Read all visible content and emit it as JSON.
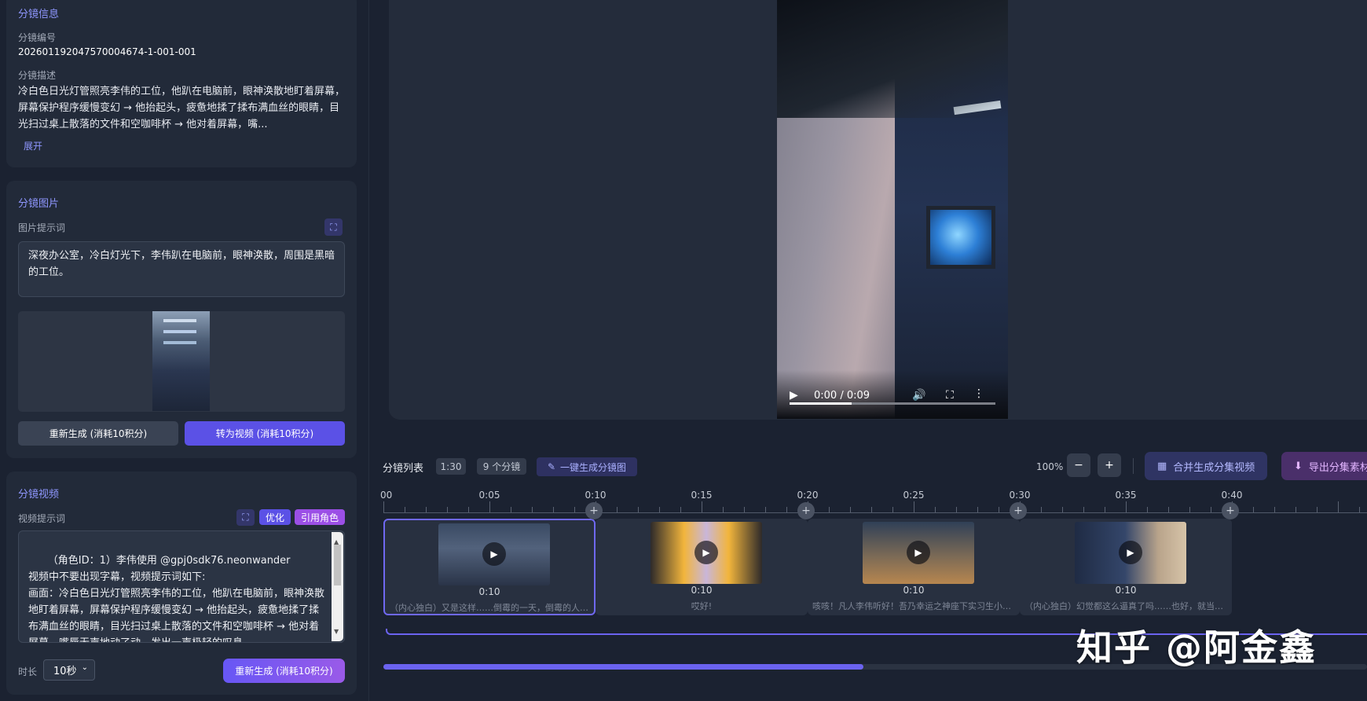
{
  "storyboard_info": {
    "title": "分镜信息",
    "id_label": "分镜编号",
    "id_value": "20260119204757000467­4-1-001-001",
    "desc_label": "分镜描述",
    "desc_text": "冷白色日光灯管照亮李伟的工位，他趴在电脑前，眼神涣散地盯着屏幕，屏幕保护程序缓慢变幻 → 他抬起头，疲惫地揉了揉布满血丝的眼睛，目光扫过桌上散落的文件和空咖啡杯 → 他对着屏幕，嘴...",
    "expand_link": "展开"
  },
  "storyboard_image": {
    "title": "分镜图片",
    "prompt_label": "图片提示词",
    "prompt_text": "深夜办公室，冷白灯光下，李伟趴在电脑前，眼神涣散，周围是黑暗的工位。",
    "regen_button": "重新生成 (消耗10积分)",
    "to_video_button": "转为视频 (消耗10积分)"
  },
  "storyboard_video": {
    "title": "分镜视频",
    "prompt_label": "视频提示词",
    "optimize_button": "优化",
    "ref_role_button": "引用角色",
    "prompt_text": "（角色ID：1）李伟使用 @gpj0sdk76.neonwander\n视频中不要出现字幕，视频提示词如下:\n画面：冷白色日光灯管照亮李伟的工位，他趴在电脑前，眼神涣散地盯着屏幕，屏幕保护程序缓慢变幻 → 他抬起头，疲惫地揉了揉布满血丝的眼睛，目光扫过桌上散落的文件和空咖啡杯 → 他对着屏幕，嘴唇无声地动了动，发出一声极轻的叹息。",
    "duration_label": "时长",
    "duration_value": "10秒",
    "regen_button": "重新生成 (消耗10积分)"
  },
  "player": {
    "time": "0:00 / 0:09",
    "progress_fraction": 0.3,
    "icons": [
      "play-icon",
      "volume-icon",
      "fullscreen-icon",
      "more-icon"
    ]
  },
  "timeline": {
    "title": "分镜列表",
    "total_duration": "1:30",
    "shot_count": "9 个分镜",
    "generate_all_button": "一键生成分镜图",
    "zoom_level": "100%",
    "merge_button": "合并生成分集视频",
    "export_button": "导出分集素材",
    "ruler_labels": [
      "00",
      "0:05",
      "0:10",
      "0:15",
      "0:20",
      "0:25",
      "0:30",
      "0:35",
      "0:40"
    ],
    "clips": [
      {
        "duration": "0:10",
        "caption": "（内心独白）又是这样……倒霉的一天，倒霉的人生。",
        "selected": true
      },
      {
        "duration": "0:10",
        "caption": "哎好!",
        "selected": false
      },
      {
        "duration": "0:10",
        "caption": "咳咳！凡人李伟听好！吾乃幸运之神座下实习生小幸...",
        "selected": false
      },
      {
        "duration": "0:10",
        "caption": "（内心独白）幻觉都这么逼真了吗……也好，就当个...",
        "selected": false
      }
    ],
    "scroll_fraction": 0.47
  },
  "watermark": "知乎 @阿金鑫",
  "colors": {
    "accent": "#5b51e6",
    "accent_text": "#8f97ff",
    "bg": "#1b2231",
    "card": "#222a39"
  }
}
